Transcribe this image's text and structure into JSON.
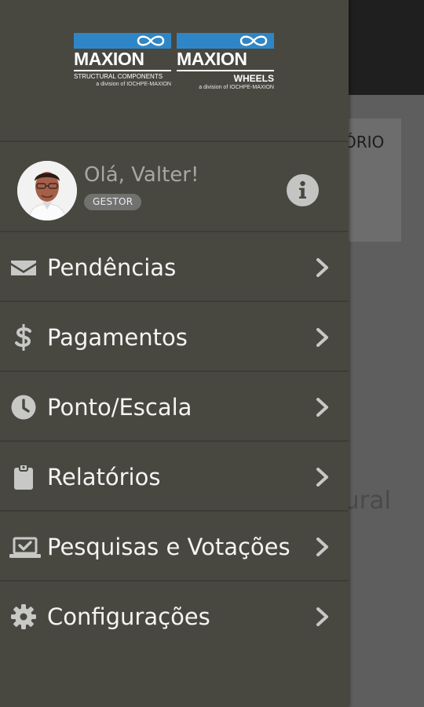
{
  "background": {
    "card_text": "ÓRIO",
    "body_text": "ural"
  },
  "logos": {
    "left": {
      "name": "MAXION",
      "subtitle": "STRUCTURAL COMPONENTS",
      "tagline": "a division of IOCHPE-MAXION"
    },
    "right": {
      "name": "MAXION",
      "subtitle": "WHEELS",
      "tagline": "a division of IOCHPE-MAXION"
    },
    "brand_color": "#2f86c7"
  },
  "profile": {
    "greeting": "Olá, Valter!",
    "role": "GESTOR",
    "info_icon": "info-circle-icon"
  },
  "menu": {
    "items": [
      {
        "label": "Pendências",
        "icon": "envelope-icon"
      },
      {
        "label": "Pagamentos",
        "icon": "dollar-icon"
      },
      {
        "label": "Ponto/Escala",
        "icon": "clock-icon"
      },
      {
        "label": "Relatórios",
        "icon": "clipboard-icon"
      },
      {
        "label": "Pesquisas e Votações",
        "icon": "laptop-check-icon"
      },
      {
        "label": "Configurações",
        "icon": "gear-icon"
      }
    ],
    "chevron_icon": "chevron-right-icon"
  },
  "colors": {
    "drawer_bg": "#484841",
    "menu_text": "#f4f4f2",
    "icon_color": "#c8c8c6",
    "greeting_text": "#a7a7a4"
  }
}
